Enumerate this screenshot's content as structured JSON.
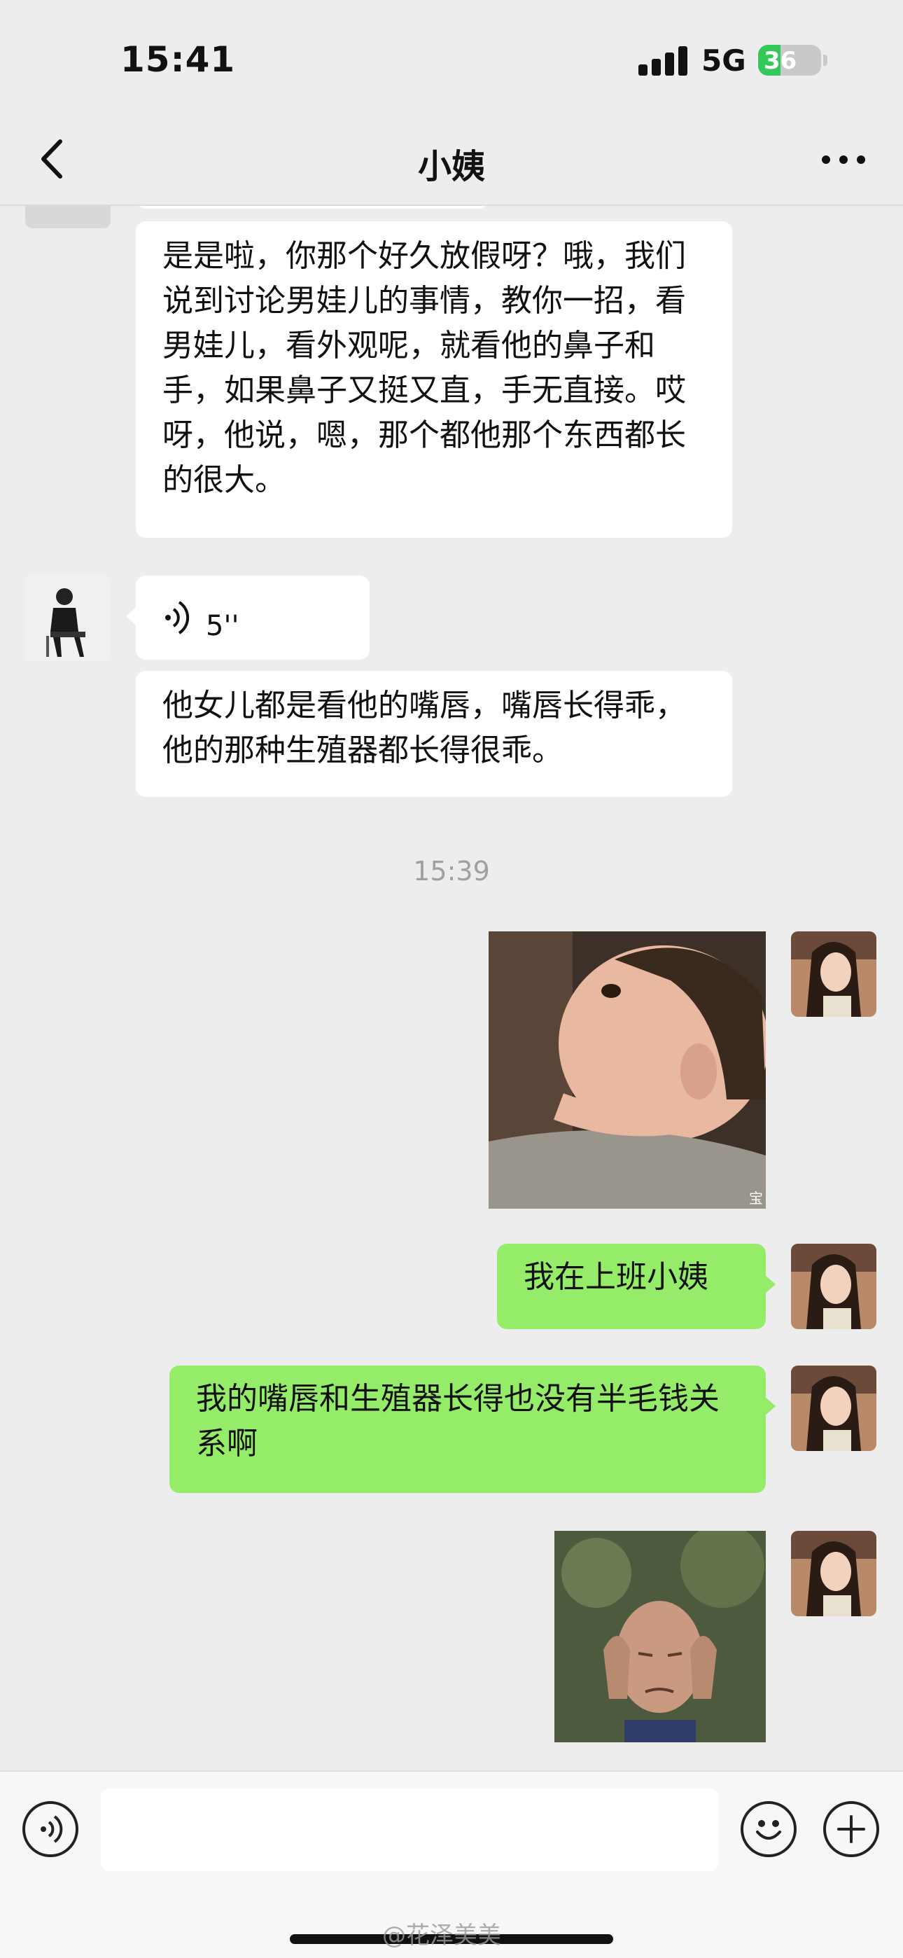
{
  "status_bar": {
    "time": "15:41",
    "network": "5G",
    "battery": "36",
    "battery_level": 0.36,
    "battery_color": "#34c759"
  },
  "nav": {
    "back_icon": "chevron-left-icon",
    "title": "小姨",
    "more_icon": "more-horizontal-icon"
  },
  "messages": [
    {
      "sender": "contact",
      "type": "text",
      "text": "是是啦，你那个好久放假呀？哦，我们说到讨论男娃儿的事情，教你一招，看男娃儿，看外观呢，就看他的鼻子和手，如果鼻子又挺又直，手无直接。哎呀，他说，嗯，那个都他那个东西都长的很大。"
    },
    {
      "sender": "contact",
      "type": "voice",
      "duration": "5''",
      "icon": "voice-wave-icon"
    },
    {
      "sender": "contact",
      "type": "text",
      "text": "他女儿都是看他的嘴唇，嘴唇长得乖，他的那种生殖器都长得很乖。"
    },
    {
      "type": "timestamp",
      "text": "15:39"
    },
    {
      "sender": "me",
      "type": "sticker",
      "description_icon": "child-looking-up-sticker",
      "caption": "宝"
    },
    {
      "sender": "me",
      "type": "text",
      "text": "我在上班小姨"
    },
    {
      "sender": "me",
      "type": "text",
      "text": "我的嘴唇和生殖器长得也没有半毛钱关系啊"
    },
    {
      "sender": "me",
      "type": "sticker",
      "description_icon": "old-man-headache-sticker"
    }
  ],
  "input_bar": {
    "voice_icon": "voice-mode-icon",
    "input_value": "",
    "emoji_icon": "emoji-icon",
    "plus_icon": "plus-icon"
  },
  "watermark": "@花泽美美",
  "colors": {
    "sent_bubble": "#95ec69",
    "recv_bubble": "#ffffff",
    "background": "#ededed"
  }
}
